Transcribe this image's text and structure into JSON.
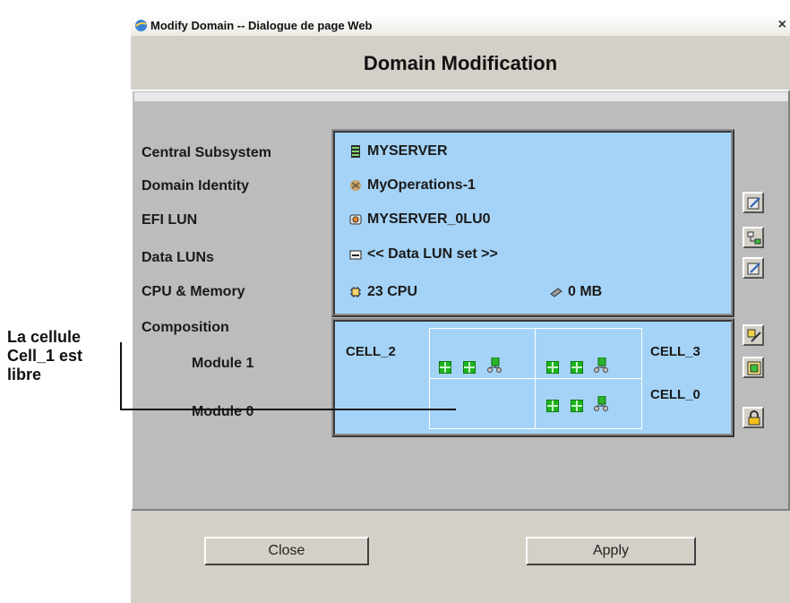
{
  "window": {
    "title": "Modify Domain -- Dialogue de page Web",
    "close_glyph": "×",
    "heading": "Domain Modification"
  },
  "fields": {
    "central_subsystem": {
      "label": "Central Subsystem",
      "value": "MYSERVER",
      "icon": "server-icon"
    },
    "domain_identity": {
      "label": "Domain Identity",
      "value": "MyOperations-1",
      "icon": "domain-icon"
    },
    "efi_lun": {
      "label": "EFI LUN",
      "value": "MYSERVER_0LU0",
      "icon": "disk-icon"
    },
    "data_luns": {
      "label": "Data LUNs",
      "value": "<< Data LUN set >>",
      "icon": "drive-icon"
    },
    "cpu_memory": {
      "label": "CPU & Memory",
      "cpu": "23 CPU",
      "memory": "0 MB",
      "icon": "chip-icon",
      "mem_icon": "memory-icon"
    },
    "composition": {
      "label": "Composition"
    }
  },
  "modules": {
    "module1": "Module 1",
    "module0": "Module 0"
  },
  "cells": {
    "cell2": "CELL_2",
    "cell3": "CELL_3",
    "cell0": "CELL_0"
  },
  "buttons": {
    "close": "Close",
    "apply": "Apply"
  },
  "annotation": {
    "line1": "La cellule",
    "line2": "Cell_1 est",
    "line3": "libre"
  },
  "colors": {
    "info_bg": "#a5d3f7",
    "dialog_bg": "#d4d0c8",
    "panel_bg": "#bcbcbc",
    "cpu_green": "#1fb31f"
  }
}
